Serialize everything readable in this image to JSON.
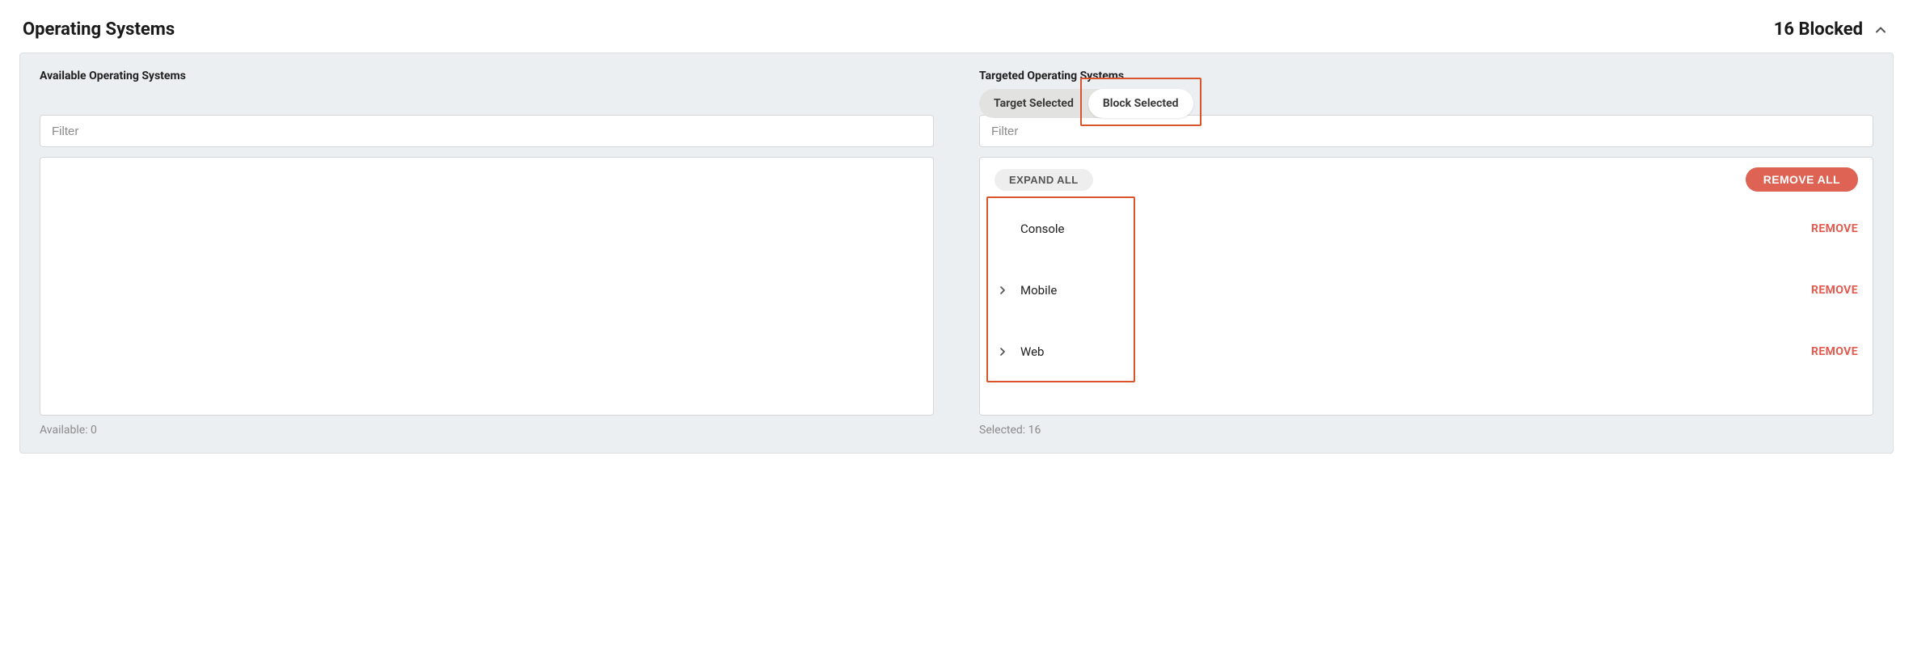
{
  "header": {
    "title": "Operating Systems",
    "status": "16 Blocked"
  },
  "available": {
    "title": "Available Operating Systems",
    "filter_placeholder": "Filter",
    "footer": "Available: 0"
  },
  "targeted": {
    "title": "Targeted Operating Systems",
    "toggle": {
      "target": "Target Selected",
      "block": "Block Selected"
    },
    "filter_placeholder": "Filter",
    "expand_all": "EXPAND ALL",
    "remove_all": "REMOVE ALL",
    "remove": "REMOVE",
    "items": [
      {
        "label": "Console",
        "expandable": false
      },
      {
        "label": "Mobile",
        "expandable": true
      },
      {
        "label": "Web",
        "expandable": true
      }
    ],
    "footer": "Selected: 16"
  }
}
